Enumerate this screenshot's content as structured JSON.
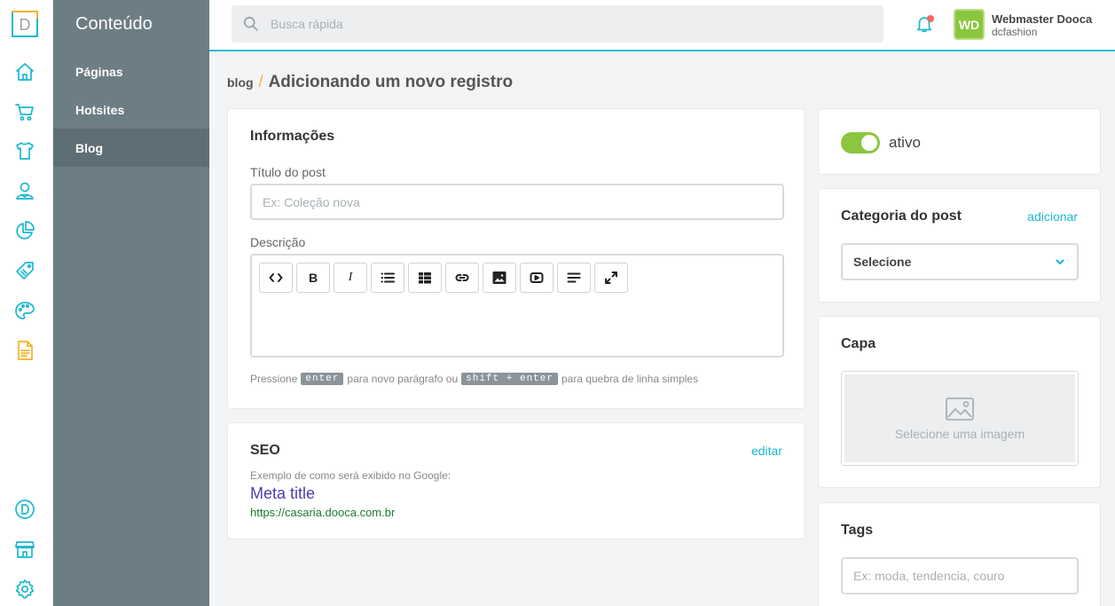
{
  "brand": {
    "logo_letter": "D",
    "accent": "#1bb8d0",
    "sidebar_bg": "#6c7d84",
    "active_green": "#8cc63f"
  },
  "rail": {
    "icons": [
      "home-icon",
      "cart-icon",
      "shirt-icon",
      "user-icon",
      "chart-icon",
      "tag-icon",
      "palette-icon",
      "document-icon",
      "dooca-icon",
      "store-icon",
      "gear-icon"
    ]
  },
  "subnav": {
    "title": "Conteúdo",
    "items": [
      {
        "label": "Páginas"
      },
      {
        "label": "Hotsites"
      },
      {
        "label": "Blog"
      }
    ]
  },
  "topbar": {
    "search_placeholder": "Busca rápida",
    "avatar_initials": "WD",
    "user_name": "Webmaster Dooca",
    "user_store": "dcfashion"
  },
  "breadcrumb": {
    "parent": "blog",
    "separator": "/",
    "current": "Adicionando um novo registro"
  },
  "info": {
    "title": "Informações",
    "post_title_label": "Título do post",
    "post_title_placeholder": "Ex: Coleção nova",
    "description_label": "Descrição",
    "toolbar": {
      "bold": "B",
      "italic": "I"
    },
    "hint": {
      "pre": "Pressione",
      "key1": "enter",
      "mid": "para novo parágrafo ou",
      "key2": "shift + enter",
      "post": "para quebra de linha simples"
    }
  },
  "seo": {
    "title": "SEO",
    "edit": "editar",
    "example": "Exemplo de como será exibido no Google:",
    "meta_title": "Meta title",
    "url": "https://casaria.dooca.com.br"
  },
  "status": {
    "label": "ativo",
    "active": true
  },
  "category": {
    "title": "Categoria do post",
    "add": "adicionar",
    "selected": "Selecione"
  },
  "cover": {
    "title": "Capa",
    "placeholder": "Selecione uma imagem"
  },
  "tags": {
    "title": "Tags",
    "placeholder": "Ex: moda, tendencia, couro"
  }
}
